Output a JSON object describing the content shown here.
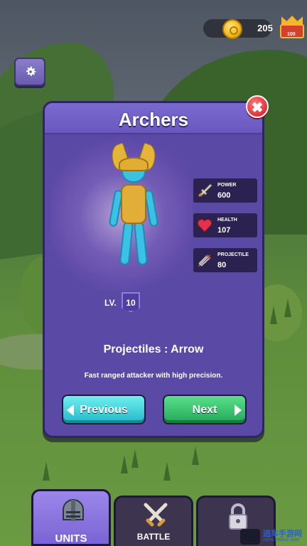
{
  "hud": {
    "coins": "205",
    "chest_count": "100"
  },
  "modal": {
    "title": "Archers",
    "level_label": "LV.",
    "level_value": "10",
    "stats": [
      {
        "label": "POWER",
        "value": "600",
        "icon": "sword-icon"
      },
      {
        "label": "HEALTH",
        "value": "107",
        "icon": "heart-icon"
      },
      {
        "label": "PROJECTILE",
        "value": "80",
        "icon": "arrows-icon"
      }
    ],
    "projectiles": "Projectiles : Arrow",
    "description": "Fast ranged attacker with high precision.",
    "prev_label": "Previous",
    "next_label": "Next"
  },
  "tabs": [
    {
      "label": "UNITS",
      "icon": "helmet-icon",
      "active": true
    },
    {
      "label": "BATTLE",
      "icon": "crossed-swords-icon",
      "active": false
    },
    {
      "label": "",
      "icon": "padlock-icon",
      "active": false
    }
  ],
  "watermark": {
    "text": "逍车手游网",
    "url": "www.lmwsz.com"
  }
}
